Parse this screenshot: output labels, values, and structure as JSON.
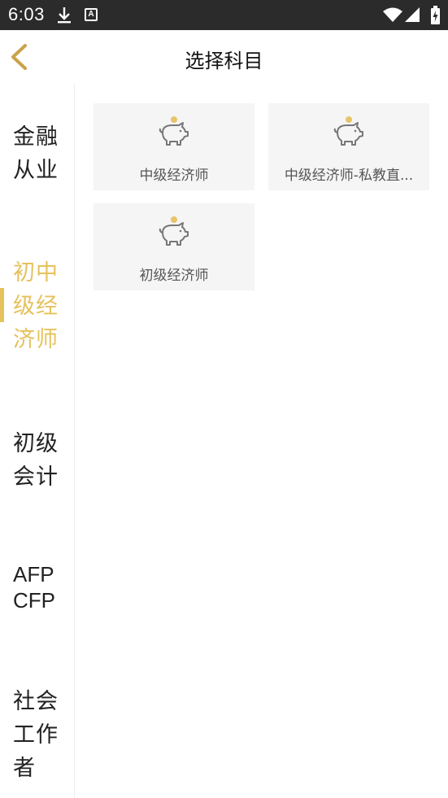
{
  "status_bar": {
    "time": "6:03",
    "icons": [
      "download-icon",
      "a-notification-icon",
      "wifi-icon",
      "signal-icon",
      "battery-icon"
    ]
  },
  "header": {
    "title": "选择科目",
    "back_icon": "chevron-left-icon"
  },
  "colors": {
    "accent": "#e5c25c",
    "status_bar_bg": "#2b2b2b",
    "card_bg": "#f5f5f5",
    "sidebar_text": "#222222"
  },
  "sidebar": {
    "items": [
      {
        "lines": [
          "金融",
          "从业"
        ],
        "active": false
      },
      {
        "lines": [
          "初中",
          "级经",
          "济师"
        ],
        "active": true
      },
      {
        "lines": [
          "初级",
          "会计"
        ],
        "active": false
      },
      {
        "lines": [
          "AFP",
          "CFP"
        ],
        "active": false
      },
      {
        "lines": [
          "社会",
          "工作",
          "者"
        ],
        "active": false
      }
    ]
  },
  "subjects": [
    {
      "label": "中级经济师",
      "icon": "piggy-bank-icon"
    },
    {
      "label": "中级经济师-私教直...",
      "icon": "piggy-bank-icon"
    },
    {
      "label": "初级经济师",
      "icon": "piggy-bank-icon"
    }
  ]
}
